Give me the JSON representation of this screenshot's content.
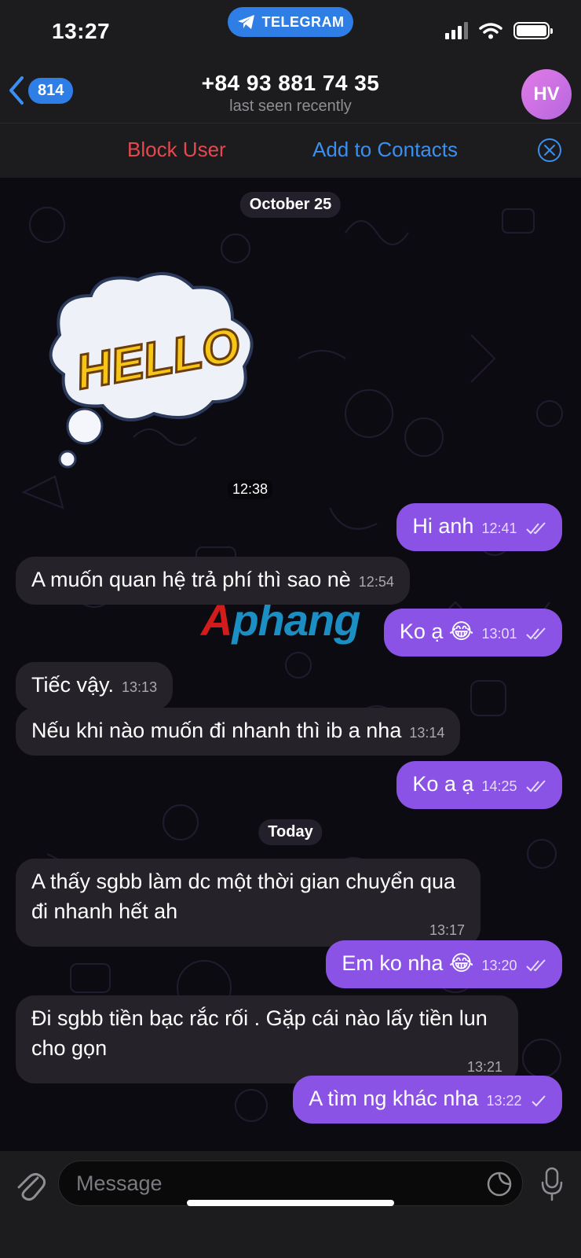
{
  "status_bar": {
    "time": "13:27",
    "app_pill": "TELEGRAM"
  },
  "header": {
    "back_count": "814",
    "title": "+84 93 881 74 35",
    "subtitle": "last seen recently",
    "avatar_initials": "HV"
  },
  "actions": {
    "block": "Block User",
    "add": "Add to Contacts"
  },
  "dates": {
    "first": "October 25",
    "second": "Today"
  },
  "sticker": {
    "text": "HELLO",
    "time": "12:38"
  },
  "watermark": {
    "part1": "A",
    "part2": "phang"
  },
  "messages": [
    {
      "dir": "out",
      "text": "Hi anh",
      "time": "12:41",
      "status": "read"
    },
    {
      "dir": "in",
      "text": "A muốn quan hệ trả phí thì sao nè",
      "time": "12:54"
    },
    {
      "dir": "out",
      "text": "Ko ạ 😂",
      "time": "13:01",
      "status": "read"
    },
    {
      "dir": "in",
      "text": "Tiếc vậy.",
      "time": "13:13"
    },
    {
      "dir": "in",
      "text": "Nếu khi nào muốn đi nhanh thì ib a nha",
      "time": "13:14"
    },
    {
      "dir": "out",
      "text": "Ko a ạ",
      "time": "14:25",
      "status": "read"
    },
    {
      "dir": "in",
      "text": "A thấy sgbb làm dc một thời gian chuyển qua đi nhanh hết ah",
      "time": "13:17"
    },
    {
      "dir": "out",
      "text": "Em ko nha 😂",
      "time": "13:20",
      "status": "read"
    },
    {
      "dir": "in",
      "text": "Đi sgbb tiền bạc rắc rối . Gặp cái nào lấy tiền lun cho gọn",
      "time": "13:21"
    },
    {
      "dir": "out",
      "text": "A tìm ng khác nha",
      "time": "13:22",
      "status": "sent"
    }
  ],
  "input": {
    "placeholder": "Message"
  },
  "colors": {
    "accent": "#2f7ee6",
    "outgoing": "#8b52e6",
    "incoming": "#262229",
    "danger": "#e5484d"
  },
  "icons": [
    "signal-icon",
    "wifi-icon",
    "battery-icon",
    "paper-plane-icon",
    "back-chevron-icon",
    "close-circle-icon",
    "paperclip-icon",
    "sticker-icon",
    "microphone-icon",
    "double-check-icon",
    "single-check-icon"
  ]
}
